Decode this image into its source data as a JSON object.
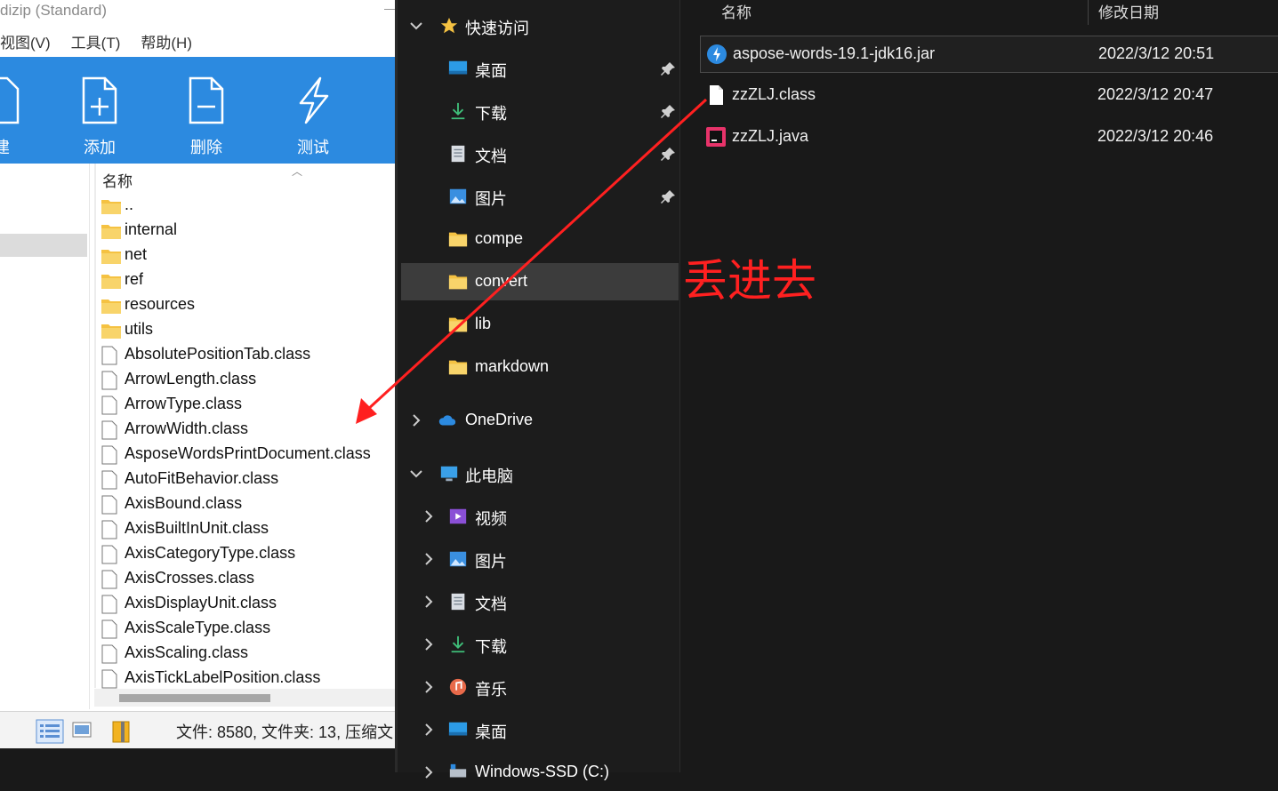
{
  "bandizip": {
    "title": "dizip (Standard)",
    "menu": [
      "视图(V)",
      "工具(T)",
      "帮助(H)"
    ],
    "toolbar": [
      {
        "label": "建",
        "icon": "new-icon"
      },
      {
        "label": "添加",
        "icon": "add-file-icon"
      },
      {
        "label": "删除",
        "icon": "delete-file-icon"
      },
      {
        "label": "测试",
        "icon": "test-bolt-icon"
      }
    ],
    "column_name": "名称",
    "rows": [
      {
        "name": "..",
        "type": "folder"
      },
      {
        "name": "internal",
        "type": "folder"
      },
      {
        "name": "net",
        "type": "folder"
      },
      {
        "name": "ref",
        "type": "folder"
      },
      {
        "name": "resources",
        "type": "folder"
      },
      {
        "name": "utils",
        "type": "folder"
      },
      {
        "name": "AbsolutePositionTab.class",
        "type": "file"
      },
      {
        "name": "ArrowLength.class",
        "type": "file"
      },
      {
        "name": "ArrowType.class",
        "type": "file"
      },
      {
        "name": "ArrowWidth.class",
        "type": "file"
      },
      {
        "name": "AsposeWordsPrintDocument.class",
        "type": "file"
      },
      {
        "name": "AutoFitBehavior.class",
        "type": "file"
      },
      {
        "name": "AxisBound.class",
        "type": "file"
      },
      {
        "name": "AxisBuiltInUnit.class",
        "type": "file"
      },
      {
        "name": "AxisCategoryType.class",
        "type": "file"
      },
      {
        "name": "AxisCrosses.class",
        "type": "file"
      },
      {
        "name": "AxisDisplayUnit.class",
        "type": "file"
      },
      {
        "name": "AxisScaleType.class",
        "type": "file"
      },
      {
        "name": "AxisScaling.class",
        "type": "file"
      },
      {
        "name": "AxisTickLabelPosition.class",
        "type": "file"
      }
    ],
    "status": "文件: 8580, 文件夹: 13, 压缩文"
  },
  "nav": {
    "quick_access": "快速访问",
    "items": [
      {
        "label": "桌面",
        "icon": "desktop-icon",
        "pinned": true
      },
      {
        "label": "下载",
        "icon": "download-icon",
        "pinned": true
      },
      {
        "label": "文档",
        "icon": "document-icon",
        "pinned": true
      },
      {
        "label": "图片",
        "icon": "pictures-icon",
        "pinned": true
      },
      {
        "label": "compe",
        "icon": "folder-icon",
        "pinned": false
      },
      {
        "label": "convert",
        "icon": "folder-icon",
        "pinned": false
      },
      {
        "label": "lib",
        "icon": "folder-icon",
        "pinned": false
      },
      {
        "label": "markdown",
        "icon": "folder-icon",
        "pinned": false
      }
    ],
    "onedrive": "OneDrive",
    "this_pc": "此电脑",
    "pc_items": [
      {
        "label": "视频",
        "icon": "video-icon"
      },
      {
        "label": "图片",
        "icon": "pictures-icon"
      },
      {
        "label": "文档",
        "icon": "document-icon"
      },
      {
        "label": "下载",
        "icon": "download-icon"
      },
      {
        "label": "音乐",
        "icon": "music-icon"
      },
      {
        "label": "桌面",
        "icon": "desktop-icon"
      },
      {
        "label": "Windows-SSD (C:)",
        "icon": "drive-icon"
      }
    ]
  },
  "files": {
    "col_name": "名称",
    "col_date": "修改日期",
    "rows": [
      {
        "name": "aspose-words-19.1-jdk16.jar",
        "date": "2022/3/12 20:51",
        "icon": "jar-icon"
      },
      {
        "name": "zzZLJ.class",
        "date": "2022/3/12 20:47",
        "icon": "class-file-icon"
      },
      {
        "name": "zzZLJ.java",
        "date": "2022/3/12 20:46",
        "icon": "java-file-icon"
      }
    ]
  },
  "annotation": "丢进去",
  "colors": {
    "toolbar": "#2c8ae0",
    "annotation": "#ff2020",
    "nav_bg": "#1c1c1c",
    "folder": "#f5c242"
  }
}
